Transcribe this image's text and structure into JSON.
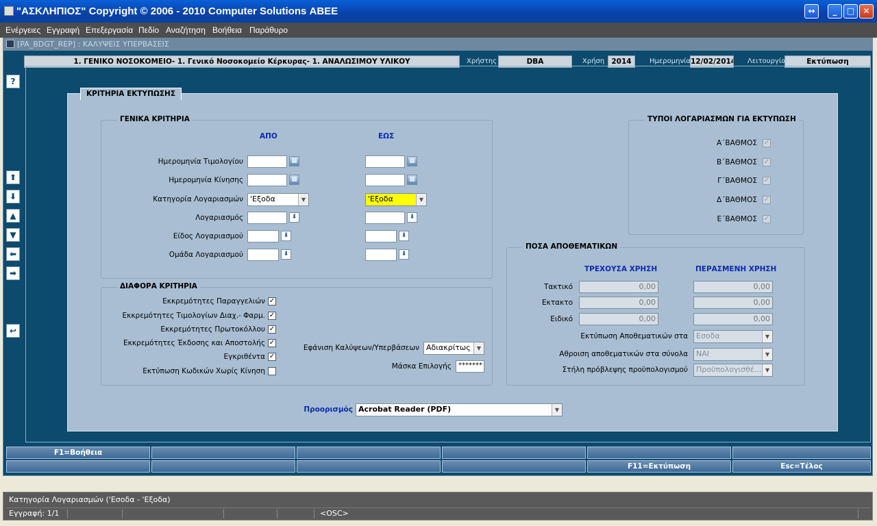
{
  "window": {
    "title": "\"ΑΣΚΛΗΠΙΟΣ\" Copyright © 2006 - 2010 Computer Solutions ΑΒΕΕ",
    "restore_glyph": "↔",
    "min_glyph": "_",
    "max_glyph": "□",
    "close_glyph": "✕"
  },
  "menu": [
    "Ενέργειες",
    "Εγγραφή",
    "Επεξεργασία",
    "Πεδίο",
    "Αναζήτηση",
    "Βοήθεια",
    "Παράθυρο"
  ],
  "module": {
    "text": "[PA_BDGT_REP]  :  ΚΑΛΥΨΕΙΣ ΥΠΕΡΒΑΣΕΙΣ"
  },
  "info": {
    "organization": "1. ΓΕΝΙΚΟ ΝΟΣΟΚΟΜΕΙΟ- 1. Γενικό Νοσοκομείο Κέρκυρας- 1. ΑΝΑΛΩΣΙΜΟΥ ΥΛΙΚΟΥ",
    "user_label": "Χρήστης",
    "user": "DBA",
    "year_label": "Χρήση",
    "year": "2014",
    "date_label": "Ημερομηνία",
    "date": "12/02/2014",
    "function_label": "Λειτουργία",
    "function": "Εκτύπωση"
  },
  "side_buttons": [
    "?",
    "⬆",
    "⬇",
    "▲",
    "▼",
    "⬅",
    "➡",
    "↩"
  ],
  "print_criteria_tab": "ΚΡΙΤΗΡΙΑ ΕΚΤΥΠΩΣΗΣ",
  "general": {
    "title": "ΓΕΝΙΚΑ ΚΡΙΤΗΡΙΑ",
    "from_header": "ΑΠΟ",
    "to_header": "ΕΩΣ",
    "rows": [
      {
        "label": "Ημερομηνία Τιμολογίου",
        "from": "",
        "to": ""
      },
      {
        "label": "Ημερομηνία Κίνησης",
        "from": "",
        "to": ""
      },
      {
        "label": "Κατηγορία Λογαριασμών",
        "from": "'Εξοδα",
        "to": "'Εξοδα"
      },
      {
        "label": "Λογαριασμός",
        "from": "",
        "to": ""
      },
      {
        "label": "Είδος Λογαριασμού",
        "from": "",
        "to": ""
      },
      {
        "label": "Ομάδα Λογαριασμού",
        "from": "",
        "to": ""
      }
    ],
    "highlight_color": "#ffff00"
  },
  "misc": {
    "title": "ΔΙΑΦΟΡΑ ΚΡΙΤΗΡΙΑ",
    "checks": [
      {
        "label": "Εκκρεμότητες Παραγγελιών",
        "checked": true
      },
      {
        "label": "Εκκρεμότητες Τιμολογίων Διαχ.- Φαρμ.",
        "checked": true
      },
      {
        "label": "Εκκρεμότητες Πρωτοκόλλου",
        "checked": true
      },
      {
        "label": "Εκκρεμότητες Έκδοσης και Αποστολής",
        "checked": true
      },
      {
        "label": "Εγκριθέντα",
        "checked": true
      },
      {
        "label": "Εκτύπωση Κωδικών Χωρίς Κίνηση",
        "checked": false
      }
    ],
    "display_label": "Εφάνιση Καλύψεων/Υπερβάσεων",
    "display_value": "Αδιακρίτως",
    "mask_label": "Μάσκα Επιλογής",
    "mask_value": "*******"
  },
  "account_types": {
    "title": "ΤΥΠΟΙ ΛΟΓΑΡΙΑΣΜΩΝ ΓΙΑ ΕΚΤΥΠΩΣΗ",
    "items": [
      {
        "label": "Α΄ΒΑΘΜΟΣ",
        "checked": true
      },
      {
        "label": "Β΄ΒΑΘΜΟΣ",
        "checked": true
      },
      {
        "label": "Γ΄ΒΑΘΜΟΣ",
        "checked": true
      },
      {
        "label": "Δ΄ΒΑΘΜΟΣ",
        "checked": true
      },
      {
        "label": "Ε΄ΒΑΘΜΟΣ",
        "checked": true
      }
    ]
  },
  "reserves": {
    "title": "ΠΟΣΑ ΑΠΟΘΕΜΑΤΙΚΩΝ",
    "current_header": "ΤΡΕΧΟΥΣΑ ΧΡΗΣΗ",
    "previous_header": "ΠΕΡΑΣΜΕΝΗ ΧΡΗΣΗ",
    "rows": [
      {
        "label": "Τακτικό",
        "current": "0,00",
        "previous": "0,00"
      },
      {
        "label": "Εκτακτο",
        "current": "0,00",
        "previous": "0,00"
      },
      {
        "label": "Ειδικό",
        "current": "0,00",
        "previous": "0,00"
      }
    ],
    "print_reserves_label": "Εκτύπωση Αποθεματικών στα",
    "print_reserves_value": "Εσοδα",
    "sum_label": "Αθροιση αποθεματικών στα σύνολα",
    "sum_value": "ΝΑΙ",
    "column_label": "Στήλη πρόβλεψης προϋπολογισμού",
    "column_value": "Προϋπολογισθέ..."
  },
  "destination": {
    "label": "Προορισμός",
    "value": "Acrobat Reader (PDF)"
  },
  "fkeys": {
    "row1": [
      "F1=Βοήθεια",
      "",
      "",
      "",
      "",
      ""
    ],
    "row2": [
      "",
      "",
      "",
      "",
      "F11=Εκτύπωση",
      "Esc=Τέλος"
    ]
  },
  "status": {
    "message": "Κατηγορία Λογαριασμών ('Εσοδα - 'Εξοδα)",
    "record": "Εγγραφή: 1/1",
    "osc": "<OSC>"
  }
}
